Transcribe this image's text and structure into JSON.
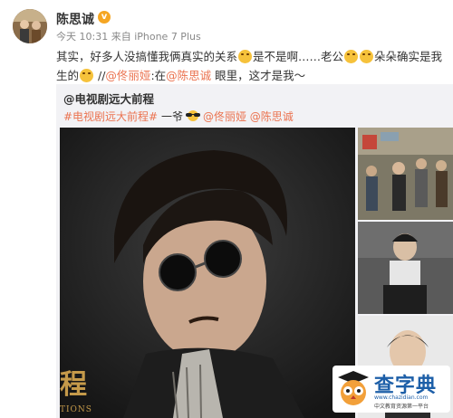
{
  "post": {
    "username": "陈思诚",
    "verified_icon": "v",
    "meta": "今天 10:31 来自 iPhone 7 Plus",
    "text_1": "其实，好多人没搞懂我俩真实的关系",
    "text_2": "是不是啊……老公",
    "text_3": "朵朵确实是我",
    "text_4": "生的",
    "text_5": " //",
    "mention_1": "@佟丽娅",
    "text_6": ":在",
    "mention_2": "@陈思诚",
    "text_7": " 眼里，这才是我～"
  },
  "repost": {
    "author": "@电视剧远大前程",
    "topic": "#电视剧远大前程#",
    "line_text": " 一爷",
    "mention_1": "@佟丽娅",
    "mention_2": "@陈思诚",
    "poster_char": "程",
    "poster_sub": "TIONS"
  },
  "watermark": {
    "title": "查字典",
    "url": "www.chazidian.com",
    "sub": "中文教育资源第一平台"
  },
  "colors": {
    "link": "#eb7350",
    "vip": "#f5a623",
    "watermark": "#1d5fa8"
  }
}
